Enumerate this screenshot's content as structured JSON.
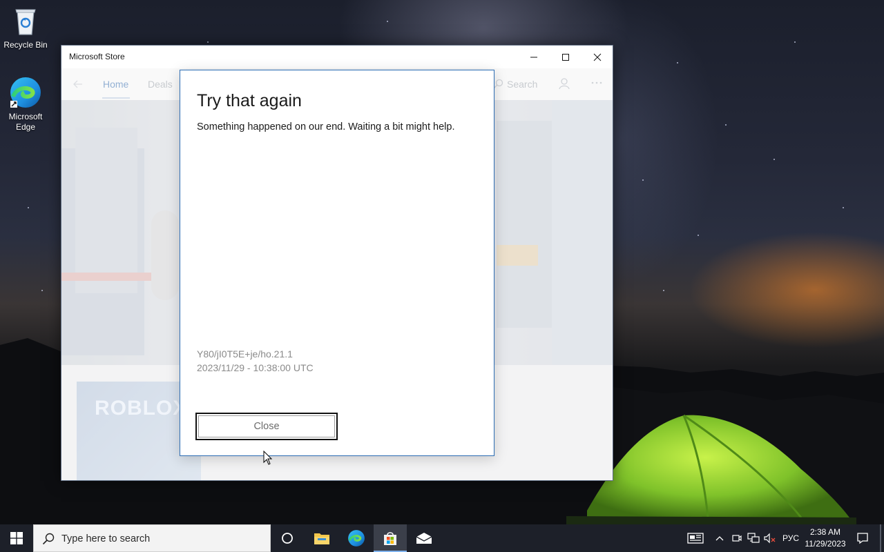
{
  "desktop": {
    "icons": [
      {
        "label": "Recycle Bin",
        "icon": "recycle-bin-icon"
      },
      {
        "label": "Microsoft Edge",
        "icon": "edge-icon"
      }
    ]
  },
  "window": {
    "title": "Microsoft Store",
    "nav": {
      "home": "Home",
      "deals": "Deals",
      "search": "Search"
    },
    "tile_text": "ROBLOX"
  },
  "dialog": {
    "title": "Try that again",
    "message": "Something happened on our end. Waiting a bit might help.",
    "code": "Y80/jI0T5E+je/ho.21.1",
    "timestamp": "2023/11/29 - 10:38:00 UTC",
    "close_label": "Close"
  },
  "taskbar": {
    "search_placeholder": "Type here to search",
    "language": "РУС",
    "time": "2:38 AM",
    "date": "11/29/2023"
  }
}
